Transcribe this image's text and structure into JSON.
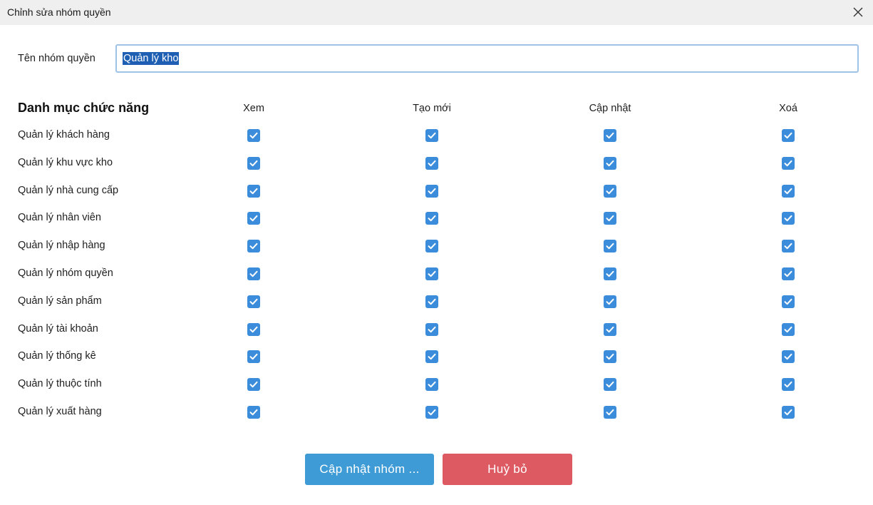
{
  "window": {
    "title": "Chỉnh sửa nhóm quyền",
    "close_icon": "close-icon"
  },
  "form": {
    "name_label": "Tên nhóm quyền",
    "name_value": "Quản lý kho",
    "name_value_selected": true
  },
  "permissions": {
    "section_title": "Danh mục chức năng",
    "columns": [
      "Xem",
      "Tạo mới",
      "Cập nhật",
      "Xoá"
    ],
    "rows": [
      {
        "label": "Quản lý khách hàng",
        "checked": [
          true,
          true,
          true,
          true
        ]
      },
      {
        "label": "Quản lý khu vực kho",
        "checked": [
          true,
          true,
          true,
          true
        ]
      },
      {
        "label": "Quản lý nhà cung cấp",
        "checked": [
          true,
          true,
          true,
          true
        ]
      },
      {
        "label": "Quản lý nhân viên",
        "checked": [
          true,
          true,
          true,
          true
        ]
      },
      {
        "label": "Quản lý nhập hàng",
        "checked": [
          true,
          true,
          true,
          true
        ]
      },
      {
        "label": "Quản lý nhóm quyền",
        "checked": [
          true,
          true,
          true,
          true
        ]
      },
      {
        "label": "Quản lý sản phẩm",
        "checked": [
          true,
          true,
          true,
          true
        ]
      },
      {
        "label": "Quản lý tài khoản",
        "checked": [
          true,
          true,
          true,
          true
        ]
      },
      {
        "label": "Quản lý thống kê",
        "checked": [
          true,
          true,
          true,
          true
        ]
      },
      {
        "label": "Quản lý thuộc tính",
        "checked": [
          true,
          true,
          true,
          true
        ]
      },
      {
        "label": "Quản lý xuất hàng",
        "checked": [
          true,
          true,
          true,
          true
        ]
      }
    ]
  },
  "actions": {
    "update_label": "Cập nhật nhóm ...",
    "cancel_label": "Huỷ bỏ"
  },
  "colors": {
    "checkbox": "#3b8ddb",
    "update_button": "#3e9bd6",
    "cancel_button": "#dd5a62",
    "selection": "#1e5fb3",
    "titlebar": "#efefef"
  }
}
